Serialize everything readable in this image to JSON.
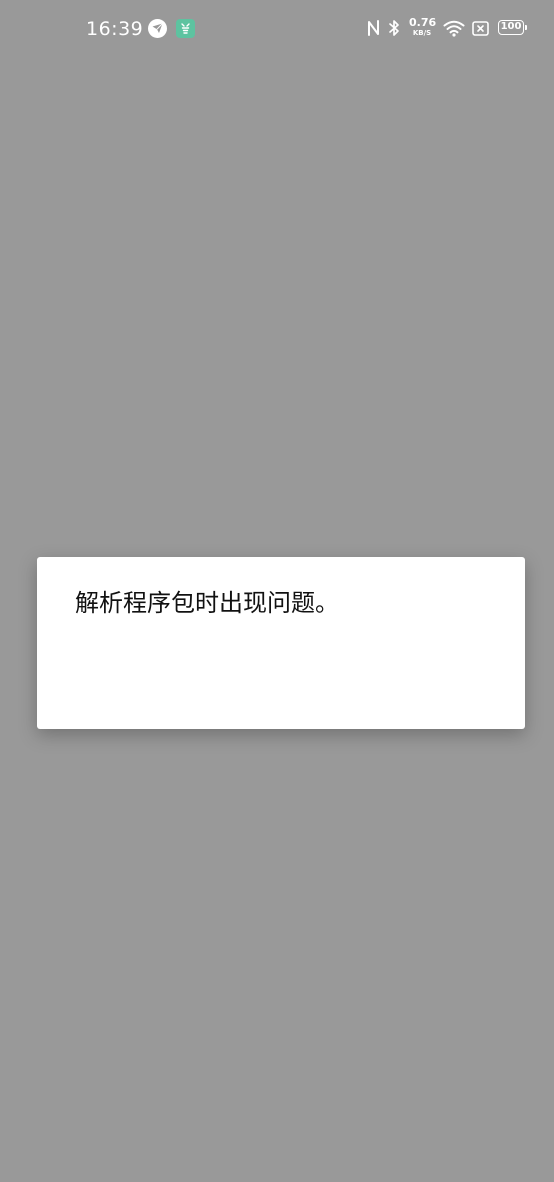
{
  "status_bar": {
    "time": "16:39",
    "notification_icons": [
      "feishu-icon",
      "app-notification-icon"
    ],
    "system_icons": [
      "nfc-icon",
      "bluetooth-icon",
      "wifi-icon",
      "sim-off-icon"
    ],
    "net_speed_value": "0.76",
    "net_speed_unit": "KB/S",
    "battery_level": "100"
  },
  "dialog": {
    "message": "解析程序包时出现问题。"
  },
  "colors": {
    "scrim": "#999999",
    "dialog_bg": "#ffffff",
    "text": "#111111",
    "app_icon_bg": "#5dc3a0"
  }
}
